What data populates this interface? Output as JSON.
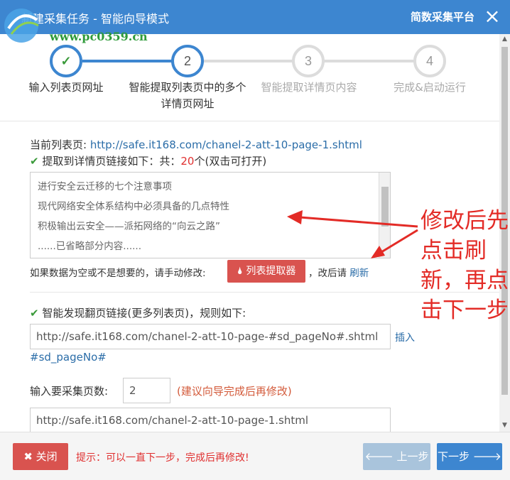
{
  "window": {
    "title": "新建采集任务 - 智能向导模式",
    "brand": "简数采集平台",
    "close_glyph": "×"
  },
  "watermark": {
    "url": "www.pc0359.cn"
  },
  "steps": [
    {
      "number": "✓",
      "label": "输入列表页网址",
      "state": "done"
    },
    {
      "number": "2",
      "label": "智能提取列表页中的多个详情页网址",
      "state": "active"
    },
    {
      "number": "3",
      "label": "智能提取详情页内容",
      "state": "pending"
    },
    {
      "number": "4",
      "label": "完成&启动运行",
      "state": "pending"
    }
  ],
  "list_page": {
    "label": "当前列表页:",
    "url": "http://safe.it168.com/chanel-2-att-10-page-1.shtml"
  },
  "extract_result": {
    "prefix": "提取到详情页链接如下：共：",
    "count": "20",
    "suffix": "个(双击可打开)"
  },
  "detail_links": [
    "进行安全云迁移的七个注意事项",
    "现代网络安全体系结构中必须具备的几点特性",
    "积极输出云安全——派拓网络的“向云之路”",
    "......已省略部分内容......"
  ],
  "manual_modify": {
    "text": "如果数据为空或不是想要的，请手动修改:",
    "button": "列表提取器",
    "after": "，改后请",
    "refresh": "刷新"
  },
  "pagination": {
    "label": "智能发现翻页链接(更多列表页)，规则如下:",
    "rule": "http://safe.it168.com/chanel-2-att-10-page-#sd_pageNo#.shtml",
    "insert": "插入",
    "token": "#sd_pageNo#"
  },
  "page_count": {
    "label": "输入要采集页数:",
    "value": "2",
    "hint": "(建议向导完成后再修改)"
  },
  "preview_url": "http://safe.it168.com/chanel-2-att-10-page-1.shtml",
  "footer": {
    "close_label": "关闭",
    "tip": "提示：可以一直下一步，完成后再修改!",
    "prev_label": "上一步",
    "next_label": "下一步"
  },
  "annotation": "修改后先点击刷新，再点击下一步",
  "colors": {
    "titlebar": "#3d86d0",
    "done": "#3a9a3a",
    "active_ring": "#3d86d0",
    "pending_ring": "#dcdcdc",
    "danger": "#d9534f",
    "primary": "#3d86d0",
    "annotation": "#e32b26"
  }
}
